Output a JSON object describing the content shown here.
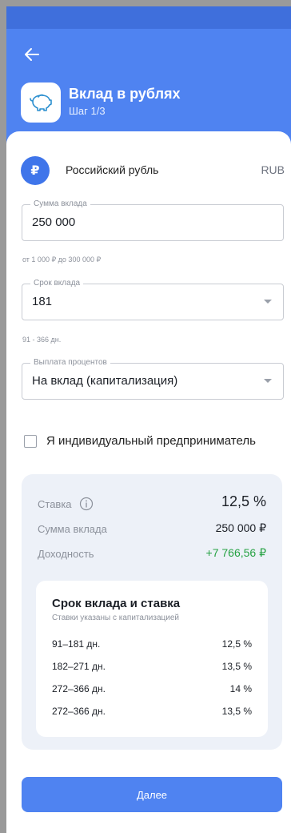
{
  "header": {
    "title": "Вклад в рублях",
    "step": "Шаг 1/3"
  },
  "currency": {
    "symbol": "₽",
    "name": "Российский рубль",
    "code": "RUB"
  },
  "amount_field": {
    "label": "Сумма вклада",
    "value": "250 000",
    "hint": "от 1 000 ₽ до 300 000 ₽"
  },
  "term_field": {
    "label": "Срок вклада",
    "value": "181",
    "hint": "91 - 366 дн."
  },
  "payout_field": {
    "label": "Выплата процентов",
    "value": "На вклад (капитализация)"
  },
  "entrepreneur_checkbox": {
    "label": "Я индивидуальный предприниматель",
    "checked": false
  },
  "summary": {
    "rate_label": "Ставка",
    "rate_value": "12,5 %",
    "amount_label": "Сумма вклада",
    "amount_value": "250 000 ₽",
    "yield_label": "Доходность",
    "yield_value": "+7 766,56 ₽",
    "yield_color": "#27a244"
  },
  "rate_table": {
    "title": "Срок вклада и ставка",
    "subtitle": "Ставки указаны с капитализацией",
    "rows": [
      {
        "term": "91–181 дн.",
        "rate": "12,5 %"
      },
      {
        "term": "182–271 дн.",
        "rate": "13,5 %"
      },
      {
        "term": "272–366 дн.",
        "rate": "14 %"
      },
      {
        "term": "272–366 дн.",
        "rate": "13,5 %"
      }
    ]
  },
  "next_button": {
    "label": "Далее"
  },
  "colors": {
    "accent": "#4f83f1",
    "status_bar": "#3f6fdc",
    "summary_bg": "#edf1f8"
  }
}
